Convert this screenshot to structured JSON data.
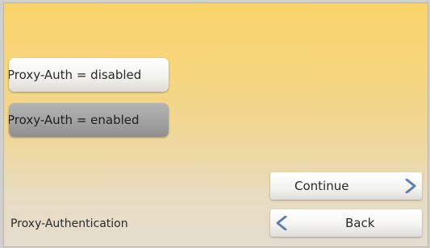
{
  "options": {
    "disabled_label": "Proxy-Auth = disabled",
    "enabled_label": "Proxy-Auth = enabled",
    "selected": "enabled"
  },
  "navigation": {
    "continue_label": "Continue",
    "back_label": "Back"
  },
  "footer": {
    "title": "Proxy-Authentication"
  },
  "colors": {
    "background_top": "#fbd36a",
    "background_bottom": "#e4ddd0",
    "selected_option": "#a2a2a2",
    "chevron": "#5f7fae"
  },
  "icons": {
    "continue": "chevron-right-icon",
    "back": "chevron-left-icon"
  }
}
